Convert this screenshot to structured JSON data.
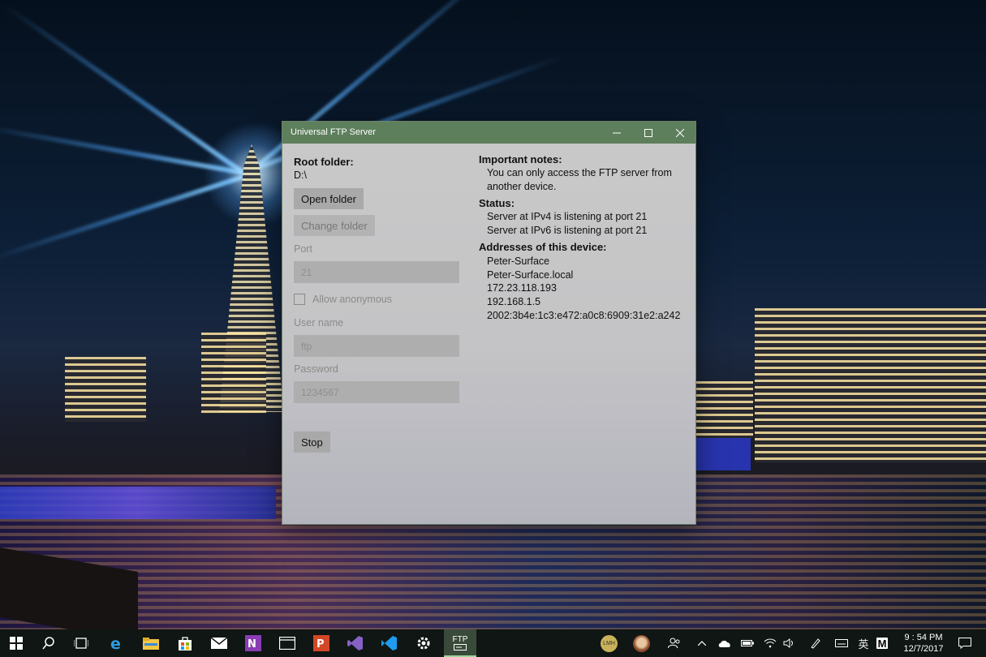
{
  "window": {
    "title": "Universal FTP Server",
    "titlebar_color": "#5e7f5c",
    "controls": {
      "minimize_icon": "minimize-icon",
      "maximize_icon": "maximize-icon",
      "close_icon": "close-icon"
    }
  },
  "left": {
    "root_folder_label": "Root folder:",
    "root_folder_value": "D:\\",
    "open_folder_button": "Open folder",
    "change_folder_button": "Change folder",
    "port_label": "Port",
    "port_value": "21",
    "allow_anonymous_label": "Allow anonymous",
    "allow_anonymous_checked": false,
    "username_label": "User name",
    "username_value": "ftp",
    "password_label": "Password",
    "password_value": "1234567",
    "stop_button": "Stop"
  },
  "right": {
    "notes_heading": "Important notes:",
    "notes_lines": [
      "You can only access the FTP server from",
      "another device."
    ],
    "status_heading": "Status:",
    "status_lines": [
      "Server at IPv4 is listening at port 21",
      "Server at IPv6 is listening at port 21"
    ],
    "addresses_heading": "Addresses of this device:",
    "addresses": [
      "Peter-Surface",
      "Peter-Surface.local",
      "172.23.118.193",
      "192.168.1.5",
      "2002:3b4e:1c3:e472:a0c8:6909:31e2:a242"
    ]
  },
  "taskbar": {
    "apps": [
      "start-icon",
      "search-icon",
      "task-view-icon",
      "edge-icon",
      "file-explorer-icon",
      "store-icon",
      "mail-icon",
      "onenote-icon",
      "window-icon",
      "powerpoint-icon",
      "visual-studio-icon",
      "vscode-icon",
      "settings-icon",
      "ftp-app-icon"
    ],
    "ftp_app_label": "FTP",
    "tray": {
      "avatar1_initials": "LMH",
      "ime_char": "英",
      "m_char": "M",
      "time": "9 : 54 PM",
      "date": "12/7/2017"
    }
  }
}
